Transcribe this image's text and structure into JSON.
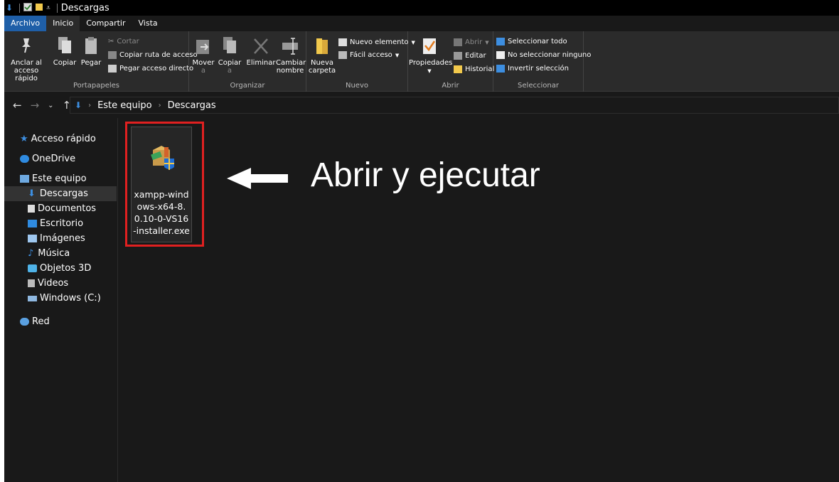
{
  "window": {
    "title": "Descargas"
  },
  "tabs": [
    "Archivo",
    "Inicio",
    "Compartir",
    "Vista"
  ],
  "ribbon": {
    "portapapeles": {
      "label": "Portapapeles",
      "pin_label_1": "Anclar al",
      "pin_label_2": "acceso rápido",
      "copy": "Copiar",
      "paste": "Pegar",
      "cut": "Cortar",
      "copy_path": "Copiar ruta de acceso",
      "paste_shortcut": "Pegar acceso directo"
    },
    "organizar": {
      "label": "Organizar",
      "move_1": "Mover",
      "move_2": "a",
      "copy_1": "Copiar",
      "copy_2": "a",
      "delete": "Eliminar",
      "rename_1": "Cambiar",
      "rename_2": "nombre"
    },
    "nuevo": {
      "label": "Nuevo",
      "new_folder_1": "Nueva",
      "new_folder_2": "carpeta",
      "new_item": "Nuevo elemento",
      "easy_access": "Fácil acceso"
    },
    "abrir": {
      "label": "Abrir",
      "properties": "Propiedades",
      "open": "Abrir",
      "edit": "Editar",
      "history": "Historial"
    },
    "seleccionar": {
      "label": "Seleccionar",
      "select_all": "Seleccionar todo",
      "select_none": "No seleccionar ninguno",
      "invert": "Invertir selección"
    }
  },
  "address": {
    "crumbs": [
      "Este equipo",
      "Descargas"
    ]
  },
  "sidebar": {
    "items": [
      "Acceso rápido",
      "OneDrive",
      "Este equipo",
      "Descargas",
      "Documentos",
      "Escritorio",
      "Imágenes",
      "Música",
      "Objetos 3D",
      "Videos",
      "Windows (C:)",
      "Red"
    ]
  },
  "file": {
    "name": "xampp-windows-x64-8.0.10-0-VS16-installer.exe"
  },
  "annotation": {
    "text": "Abrir y ejecutar"
  },
  "colors": {
    "accent": "#1f5fa8",
    "highlight": "#e02020",
    "background": "#191919"
  }
}
